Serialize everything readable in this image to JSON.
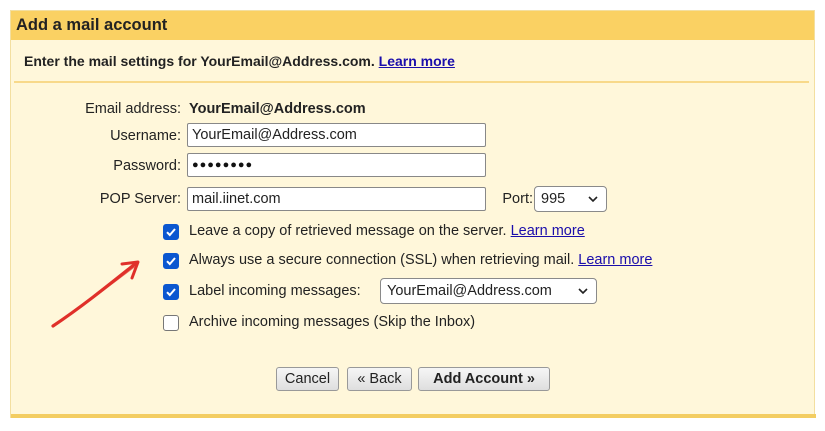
{
  "dialog": {
    "title": "Add a mail account",
    "subtitle": "Enter the mail settings for YourEmail@Address.com.",
    "subtitle_link": "Learn more"
  },
  "form": {
    "email_label": "Email address:",
    "email_value": "YourEmail@Address.com",
    "username_label": "Username:",
    "username_value": "YourEmail@Address.com",
    "password_label": "Password:",
    "password_mask": "●●●●●●●●",
    "pop_label": "POP Server:",
    "pop_value": "mail.iinet.com",
    "port_label": "Port:",
    "port_value": "995"
  },
  "options": [
    {
      "label": "Leave a copy of retrieved message on the server.",
      "link": "Learn more",
      "checked": true
    },
    {
      "label": "Always use a secure connection (SSL) when retrieving mail.",
      "link": "Learn more",
      "checked": true
    },
    {
      "label": "Label incoming messages:",
      "select_value": "YourEmail@Address.com",
      "checked": true
    },
    {
      "label": "Archive incoming messages (Skip the Inbox)",
      "checked": false
    }
  ],
  "buttons": {
    "cancel": "Cancel",
    "back": "« Back",
    "add": "Add Account »"
  },
  "colors": {
    "title_bar": "#fad163",
    "panel_bg": "#fff7da",
    "checkbox": "#0b57d0",
    "annotation_arrow": "#e0302a"
  }
}
